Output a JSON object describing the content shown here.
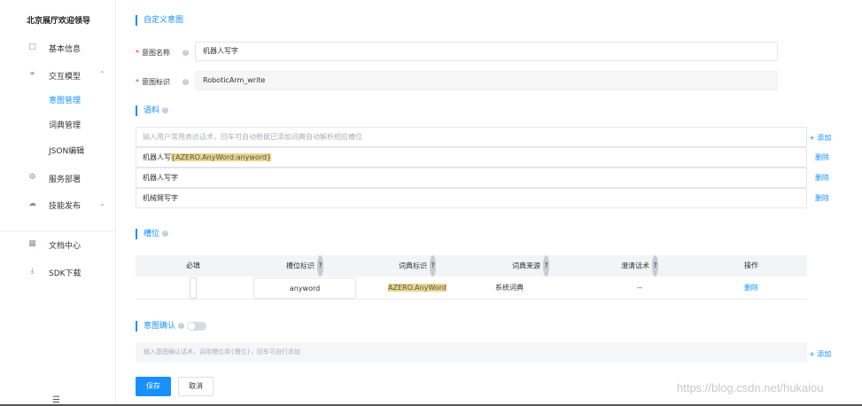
{
  "sidebar": {
    "brand": "北京展厅欢迎领导",
    "items": [
      {
        "icon": "document-icon",
        "label": "基本信息"
      },
      {
        "icon": "interaction-icon",
        "label": "交互模型"
      },
      {
        "icon": "gear-icon",
        "label": "服务部署"
      },
      {
        "icon": "cloud-upload-icon",
        "label": "技能发布"
      },
      {
        "icon": "doc-center-icon",
        "label": "文档中心"
      },
      {
        "icon": "download-icon",
        "label": "SDK下载"
      }
    ],
    "subitems": [
      "意图管理",
      "词典管理",
      "JSON编辑"
    ],
    "active_subitem": "意图管理"
  },
  "custom_intent": {
    "title": "自定义意图",
    "name_label": "意图名称",
    "name_value": "机器人写字",
    "id_label": "意图标识",
    "id_value": "RoboticArm_write"
  },
  "corpus": {
    "title": "语料",
    "placeholder": "输入用户常用表达话术，回车可自动根据已添加词典自动解析相应槽位",
    "add_label": "+ 添加",
    "delete_label": "删除",
    "rows": [
      {
        "prefix": "机器人写",
        "highlight": "{AZERO.AnyWord:anyword}"
      },
      {
        "prefix": "机器人写字",
        "highlight": ""
      },
      {
        "prefix": "机械臂写字",
        "highlight": ""
      }
    ]
  },
  "slots": {
    "title": "槽位",
    "headers": [
      "必填",
      "槽位标识",
      "词典标识",
      "词典来源",
      "澄清话术",
      "操作"
    ],
    "row": {
      "slot_id": "anyword",
      "dict_id": "AZERO.AnyWord",
      "dict_source": "系统词典",
      "clarify": "--",
      "action": "删除"
    }
  },
  "intent_confirm": {
    "title": "意图确认",
    "placeholder": "输入意图确认话术，调用槽位用{槽位}，回车可自行添加",
    "add_label": "+ 添加"
  },
  "actions": {
    "save": "保存",
    "cancel": "取消"
  },
  "watermark": "https://blog.csdn.net/hukaiou",
  "colors": {
    "accent": "#1890ff",
    "highlight": "#e8d78c"
  }
}
